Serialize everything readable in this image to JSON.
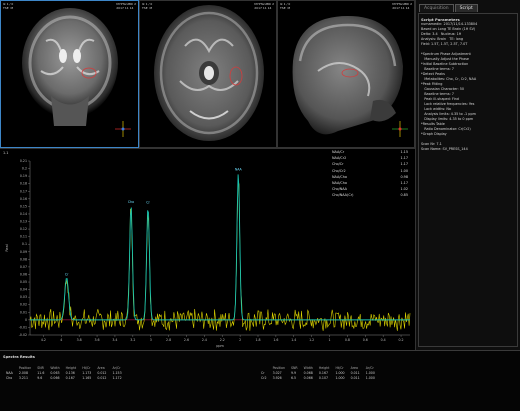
{
  "viewports": [
    {
      "overlay_tl": "Ik 1 / 0\nTSE  M",
      "overlay_tr": "MYPTanMRI 2\n2017 11 14",
      "roi": true
    },
    {
      "overlay_tl": "Ik 1 / 0\nTSE  M",
      "overlay_tr": "MYPTanMRI 2\n2017 11 14",
      "roi": true
    },
    {
      "overlay_tl": "Ik 1 / 0\nTSE  M",
      "overlay_tr": "MYPTanMRI 2\n2017 11 14",
      "roi": true
    }
  ],
  "orientation": {
    "top": "H",
    "bottom": "F",
    "left": "R",
    "right": "L",
    "top2": "A",
    "bottom2": "P"
  },
  "side_panel": {
    "tabs": [
      "Acquisition",
      "Script"
    ],
    "lines": [
      {
        "text": "Script Parameters",
        "head": true
      },
      {
        "text": "numamedin: 2017/11/14-133804",
        "head": false
      },
      {
        "text": "Based on Long TE Brain (1H SV)",
        "head": false
      },
      {
        "text": "Delta: 3.4   Nucleus: 1H",
        "head": false
      },
      {
        "text": "Analysis: Brain   TE: long",
        "head": false
      },
      {
        "text": "Field: 1.5T, 1.5T, 2.5T, 7.0T",
        "head": false
      },
      {
        "text": "",
        "head": false
      },
      {
        "text": "*Spectrum Phase Adjustment",
        "head": false
      },
      {
        "text": "   Manually Adjust the Phase",
        "head": false
      },
      {
        "text": "*Initial Baseline Subtraction",
        "head": false
      },
      {
        "text": "   Baseline terms: 7",
        "head": false
      },
      {
        "text": "*Detect Peaks",
        "head": false
      },
      {
        "text": "   Metabolites: Cho, Cr, Cr2, NAA",
        "head": false
      },
      {
        "text": "*Peak Fitting",
        "head": false
      },
      {
        "text": "   Gaussian Character: 50",
        "head": false
      },
      {
        "text": "   Baseline terms: 7",
        "head": false
      },
      {
        "text": "   Peak ill-shaped: Find",
        "head": false
      },
      {
        "text": "   Lock relative frequencies: Yes",
        "head": false
      },
      {
        "text": "   Lock widths: No",
        "head": false
      },
      {
        "text": "   Analysis limits: 4.35 to -1 ppm",
        "head": false
      },
      {
        "text": "   Display limits: 4.35 to 0 ppm",
        "head": false
      },
      {
        "text": "*Results Table",
        "head": false
      },
      {
        "text": "   Ratio Denominator: Cr(Cr2)",
        "head": false
      },
      {
        "text": "*Graph Display",
        "head": false
      },
      {
        "text": "",
        "head": false
      },
      {
        "text": "Scan Nr: 7.1",
        "head": false
      },
      {
        "text": "Scan Name: SV_PRESS_144",
        "head": false
      }
    ]
  },
  "spectrum": {
    "label": "1.1",
    "ratios": [
      {
        "label": "NAA/Cr",
        "value": "1.15"
      },
      {
        "label": "NAA/Cr2",
        "value": "1.17"
      },
      {
        "label": "Cho/Cr",
        "value": "1.17"
      },
      {
        "label": "Cho/Cr2",
        "value": "1.00"
      },
      {
        "label": "NAA/Cho",
        "value": "0.98"
      },
      {
        "label": "NAA/Cho",
        "value": "1.17"
      },
      {
        "label": "Cho/NAA",
        "value": "1.02"
      },
      {
        "label": "Cho/NAA(Cr)",
        "value": "0.85"
      }
    ],
    "y_ticks": [
      "0.21",
      "0.2",
      "0.19",
      "0.18",
      "0.17",
      "0.16",
      "0.15",
      "0.14",
      "0.13",
      "0.12",
      "0.11",
      "0.1",
      "0.09",
      "0.08",
      "0.07",
      "0.06",
      "0.05",
      "0.04",
      "0.03",
      "0.02",
      "0.01",
      "0",
      "-0.01",
      "-0.02"
    ],
    "x_ticks": [
      "4.2",
      "4",
      "3.8",
      "3.6",
      "3.4",
      "3.2",
      "3",
      "2.8",
      "2.6",
      "2.4",
      "2.2",
      "2",
      "1.8",
      "1.6",
      "1.4",
      "1.2",
      "1",
      "0.8",
      "0.6",
      "0.4",
      "0.2"
    ],
    "x_unit": "ppm",
    "y_unit": "Real",
    "peaks": [
      {
        "label": "Cr",
        "ppm": 4.0
      },
      {
        "label": "Cr",
        "ppm": 3.03
      },
      {
        "label": "Cho",
        "ppm": 3.22
      },
      {
        "label": "NAA",
        "ppm": 2.02
      }
    ]
  },
  "chart_data": {
    "type": "line",
    "xlabel": "ppm",
    "ylabel": "Real",
    "xlim": [
      4.35,
      0.1
    ],
    "ylim": [
      -0.02,
      0.21
    ],
    "series": [
      {
        "name": "fit",
        "peaks": [
          {
            "ppm": 3.94,
            "height": 0.056,
            "width": 0.03
          },
          {
            "ppm": 3.22,
            "height": 0.152,
            "width": 0.022
          },
          {
            "ppm": 3.03,
            "height": 0.151,
            "width": 0.022
          },
          {
            "ppm": 2.02,
            "height": 0.195,
            "width": 0.022
          }
        ]
      },
      {
        "name": "residual",
        "amplitude": 0.012
      }
    ],
    "colors": {
      "fit": "#19c3b0",
      "signal": "#dcd300",
      "baseline": "#e0205a"
    }
  },
  "results": {
    "title": "Spectra Results",
    "left_headers": [
      "",
      "Position",
      "SNR",
      "Width",
      "Height",
      "Ht/Cr",
      "Area",
      "Ar/Cr"
    ],
    "left_rows": [
      [
        "NAA",
        "2.008",
        "11.6",
        "0.063",
        "0.136",
        "1.173",
        "0.012",
        "1.153"
      ],
      [
        "Cho",
        "3.211",
        "9.6",
        "0.066",
        "0.167",
        "1.165",
        "0.012",
        "1.172"
      ]
    ],
    "right_headers": [
      "",
      "Position",
      "SNR",
      "Width",
      "Height",
      "Ht/Cr",
      "Area",
      "Ar/Cr"
    ],
    "right_rows": [
      [
        "Cr",
        "3.027",
        "9.9",
        "0.068",
        "0.167",
        "1.000",
        "0.011",
        "1.000"
      ],
      [
        "Cr2",
        "3.926",
        "6.5",
        "0.066",
        "0.107",
        "1.000",
        "0.011",
        "1.000"
      ]
    ]
  }
}
